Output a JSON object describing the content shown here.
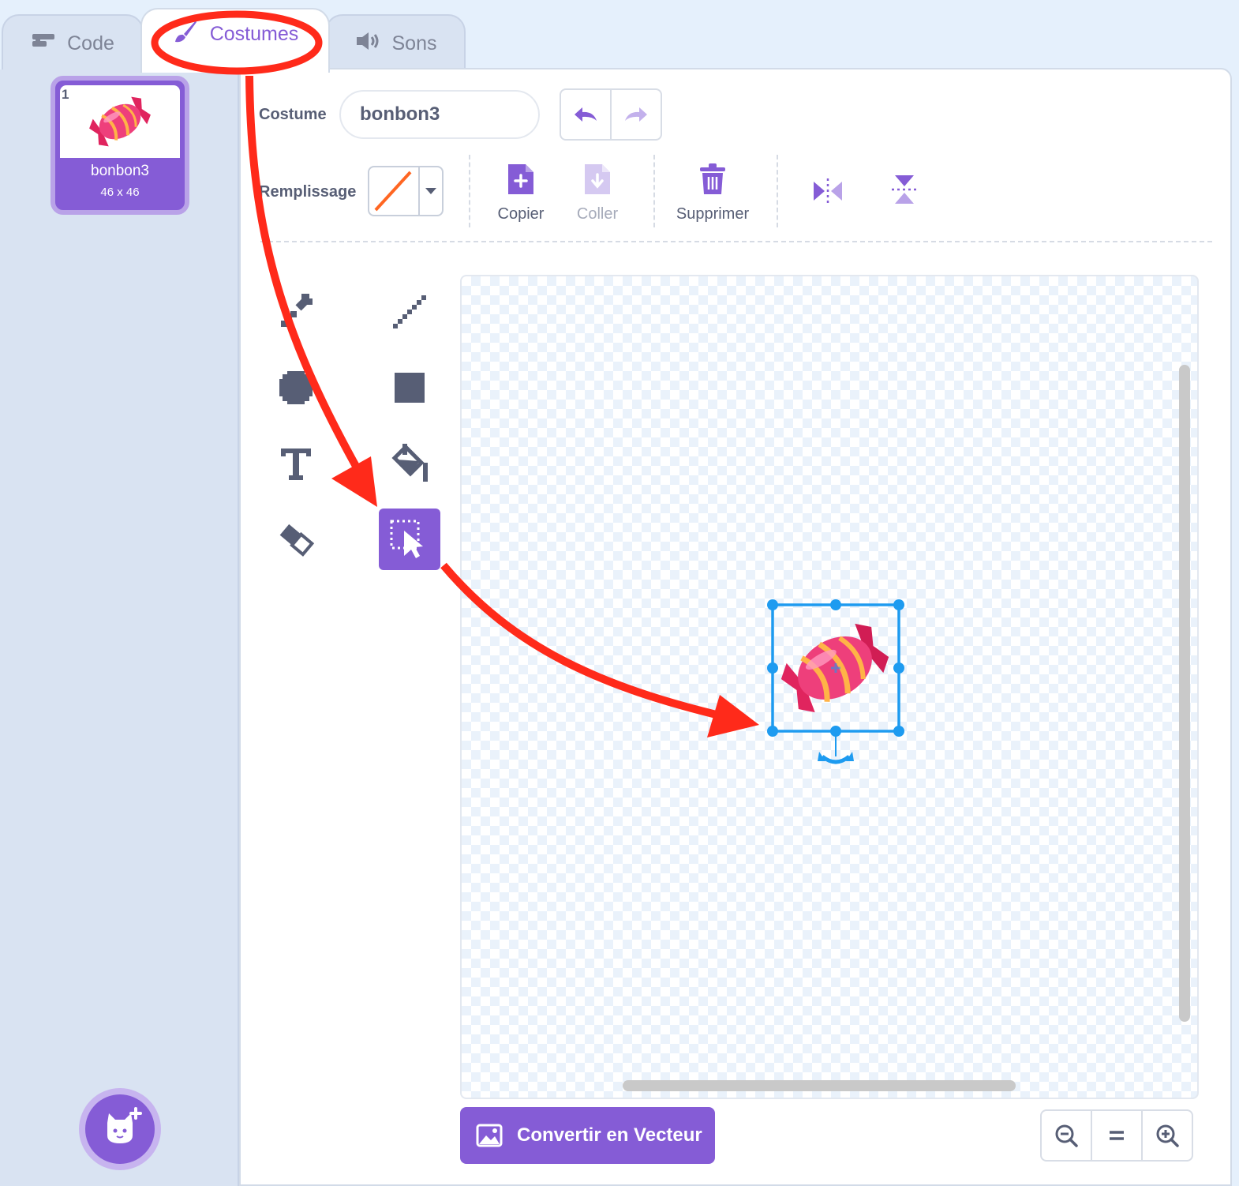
{
  "tabs": [
    {
      "label": "Code",
      "icon": "code-blocks-icon",
      "active": false
    },
    {
      "label": "Costumes",
      "icon": "paintbrush-icon",
      "active": true
    },
    {
      "label": "Sons",
      "icon": "speaker-icon",
      "active": false
    }
  ],
  "costume_list": {
    "items": [
      {
        "number": "1",
        "name": "bonbon3",
        "size": "46 x 46"
      }
    ],
    "add_button_icon": "cat-plus-icon"
  },
  "editor": {
    "costume_label": "Costume",
    "costume_name": "bonbon3",
    "fill_label": "Remplissage",
    "fill_state": "no-fill",
    "actions": {
      "copy": "Copier",
      "paste": "Coller",
      "delete": "Supprimer"
    },
    "tools": [
      "brush",
      "line",
      "circle",
      "rectangle",
      "text",
      "fill",
      "eraser",
      "select"
    ],
    "selected_tool": "select",
    "convert_button": "Convertir en Vecteur"
  },
  "annotations": {
    "arrow_color": "#ff2a1a",
    "circled_item": "Costumes"
  },
  "colors": {
    "accent": "#855cd6",
    "selection": "#1e9bf0",
    "text": "#575e75"
  }
}
